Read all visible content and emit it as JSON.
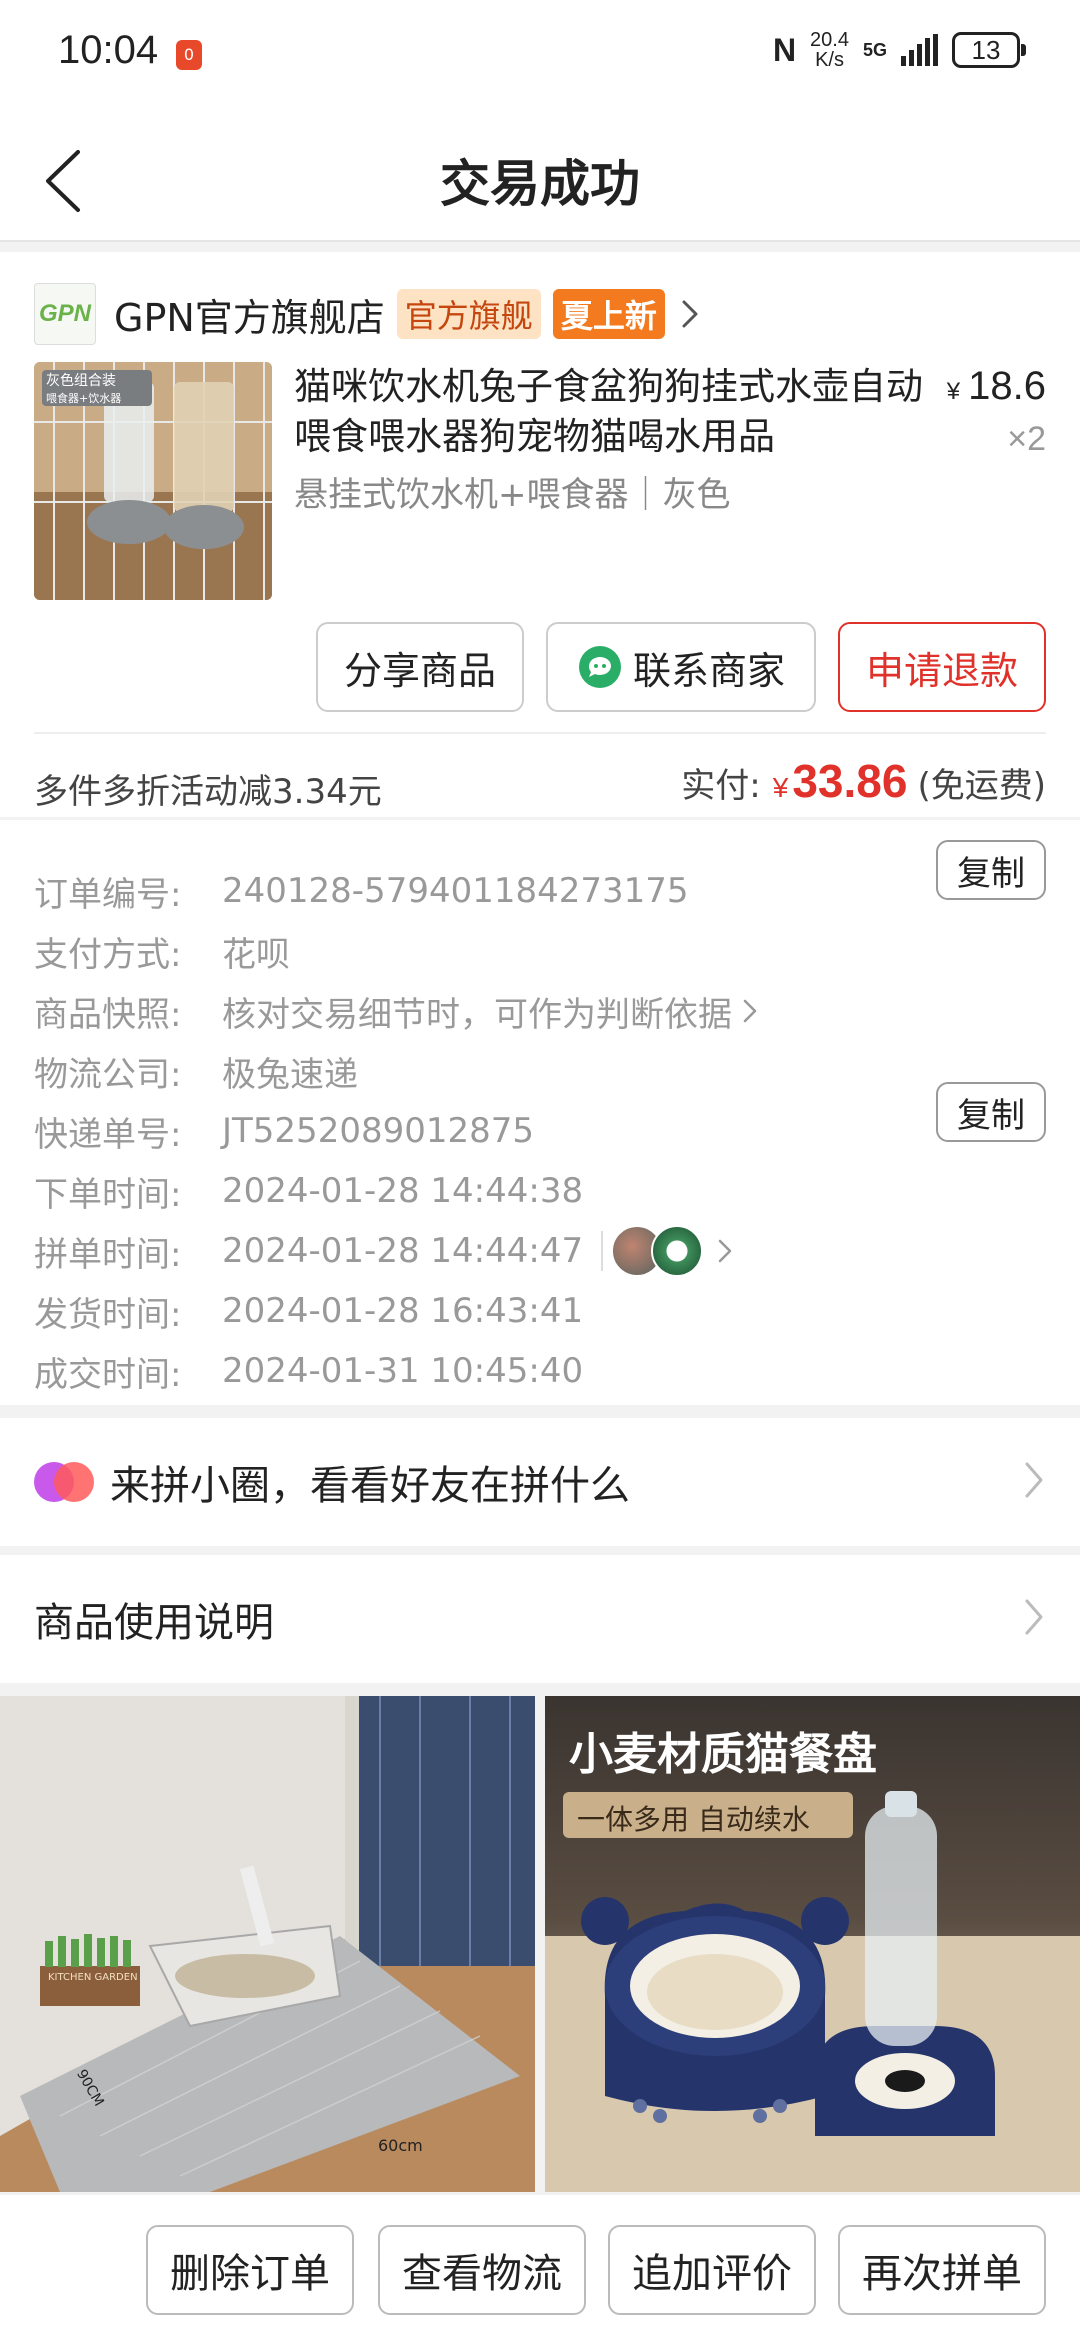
{
  "status_bar": {
    "time": "10:04",
    "notification": "0",
    "nfc": "N",
    "speed_value": "20.4",
    "speed_unit": "K/s",
    "network": "5G",
    "battery": "13"
  },
  "nav": {
    "title": "交易成功"
  },
  "shop": {
    "logo_text": "GPN",
    "name": "GPN官方旗舰店",
    "tag_official": "官方旗舰",
    "tag_new": "夏上新"
  },
  "product": {
    "title": "猫咪饮水机兔子食盆狗狗挂式水壶自动喂食喂水器狗宠物猫喝水用品",
    "spec": "悬挂式饮水机+喂食器｜灰色",
    "currency": "¥",
    "price": "18.6",
    "quantity": "×2",
    "image_badge_line1": "灰色组合装",
    "image_badge_line2": "喂食器+饮水器"
  },
  "actions": {
    "share": "分享商品",
    "contact": "联系商家",
    "refund": "申请退款"
  },
  "payment": {
    "discount": "多件多折活动减3.34元",
    "paid_label": "实付:",
    "currency": "¥",
    "paid_amount": "33.86",
    "shipping_note": "(免运费)"
  },
  "details": {
    "order_no_label": "订单编号:",
    "order_no": "240128-579401184273175",
    "pay_method_label": "支付方式:",
    "pay_method": "花呗",
    "snapshot_label": "商品快照:",
    "snapshot": "核对交易细节时，可作为判断依据",
    "logistics_label": "物流公司:",
    "logistics": "极兔速递",
    "tracking_label": "快递单号:",
    "tracking": "JT5252089012875",
    "order_time_label": "下单时间:",
    "order_time": "2024-01-28 14:44:38",
    "group_time_label": "拼单时间:",
    "group_time": "2024-01-28 14:44:47",
    "ship_time_label": "发货时间:",
    "ship_time": "2024-01-28 16:43:41",
    "deal_time_label": "成交时间:",
    "deal_time": "2024-01-31 10:45:40",
    "copy": "复制"
  },
  "circle_link": {
    "label": "来拼小圈，看看好友在拼什么"
  },
  "manual_link": {
    "label": "商品使用说明"
  },
  "gallery": {
    "left_width_label": "60cm",
    "left_height_label": "90CM",
    "left_brand": "KITCHEN GARDEN",
    "right_title": "小麦材质猫餐盘",
    "right_subtitle": "一体多用  自动续水"
  },
  "bottom_bar": {
    "delete": "删除订单",
    "logistics": "查看物流",
    "review": "追加评价",
    "reorder": "再次拼单"
  },
  "colors": {
    "accent_red": "#e0322a",
    "tag_orange": "#f37a1f",
    "tag_official_bg": "#fde2c4",
    "wechat_green": "#2aae67"
  }
}
